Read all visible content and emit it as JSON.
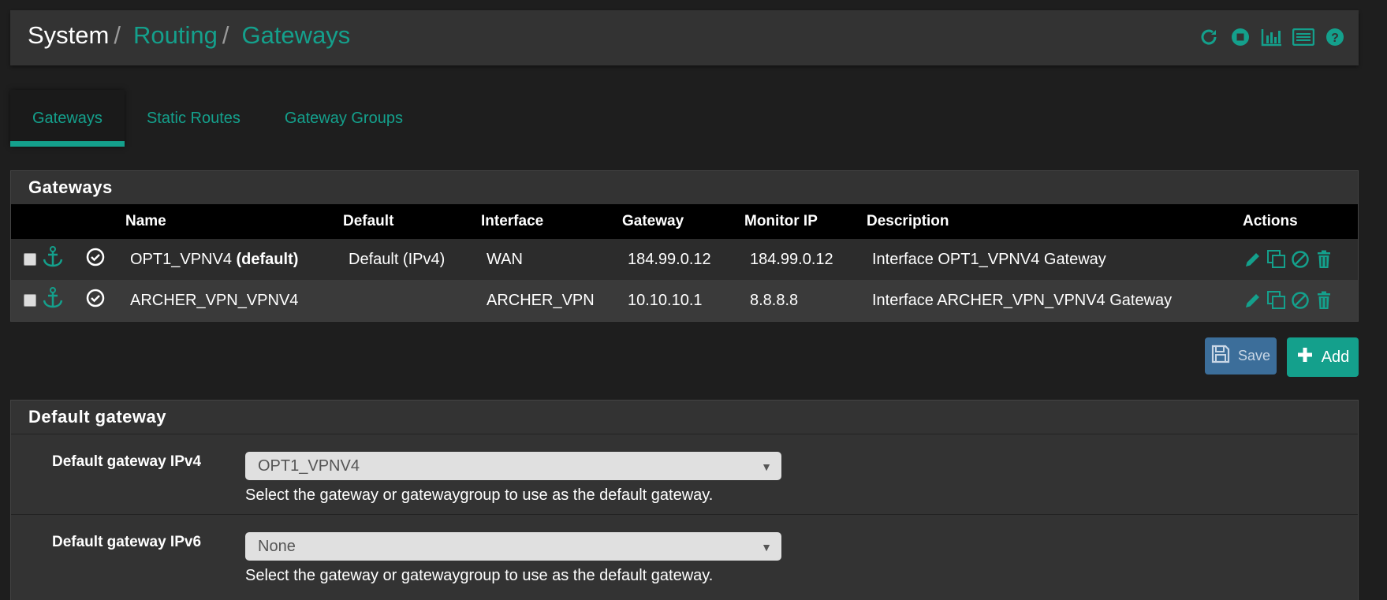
{
  "breadcrumb": {
    "root": "System",
    "separator": "/",
    "level2": "Routing",
    "level3": "Gateways"
  },
  "header_icons": [
    "reload-icon",
    "stop-icon",
    "bar-chart-icon",
    "list-icon",
    "help-icon"
  ],
  "tabs": [
    {
      "label": "Gateways",
      "active": true
    },
    {
      "label": "Static Routes",
      "active": false
    },
    {
      "label": "Gateway Groups",
      "active": false
    }
  ],
  "gateways_panel": {
    "title": "Gateways",
    "columns": [
      "Name",
      "Default",
      "Interface",
      "Gateway",
      "Monitor IP",
      "Description",
      "Actions"
    ],
    "rows": [
      {
        "name": "OPT1_VPNV4",
        "default_tag": "(default)",
        "default": "Default (IPv4)",
        "interface": "WAN",
        "gateway": "184.99.0.12",
        "monitor_ip": "184.99.0.12",
        "description": "Interface OPT1_VPNV4 Gateway"
      },
      {
        "name": "ARCHER_VPN_VPNV4",
        "default_tag": "",
        "default": "",
        "interface": "ARCHER_VPN",
        "gateway": "10.10.10.1",
        "monitor_ip": "8.8.8.8",
        "description": "Interface ARCHER_VPN_VPNV4 Gateway"
      }
    ]
  },
  "buttons": {
    "save": "Save",
    "add": "Add"
  },
  "default_gateway_panel": {
    "title": "Default gateway",
    "ipv4": {
      "label": "Default gateway IPv4",
      "value": "OPT1_VPNV4",
      "help": "Select the gateway or gatewaygroup to use as the default gateway."
    },
    "ipv6": {
      "label": "Default gateway IPv6",
      "value": "None",
      "help": "Select the gateway or gatewaygroup to use as the default gateway."
    }
  },
  "colors": {
    "accent": "#14a08c",
    "save_button": "#3c6e9a",
    "panel": "#333333",
    "background": "#1e1e1e"
  }
}
